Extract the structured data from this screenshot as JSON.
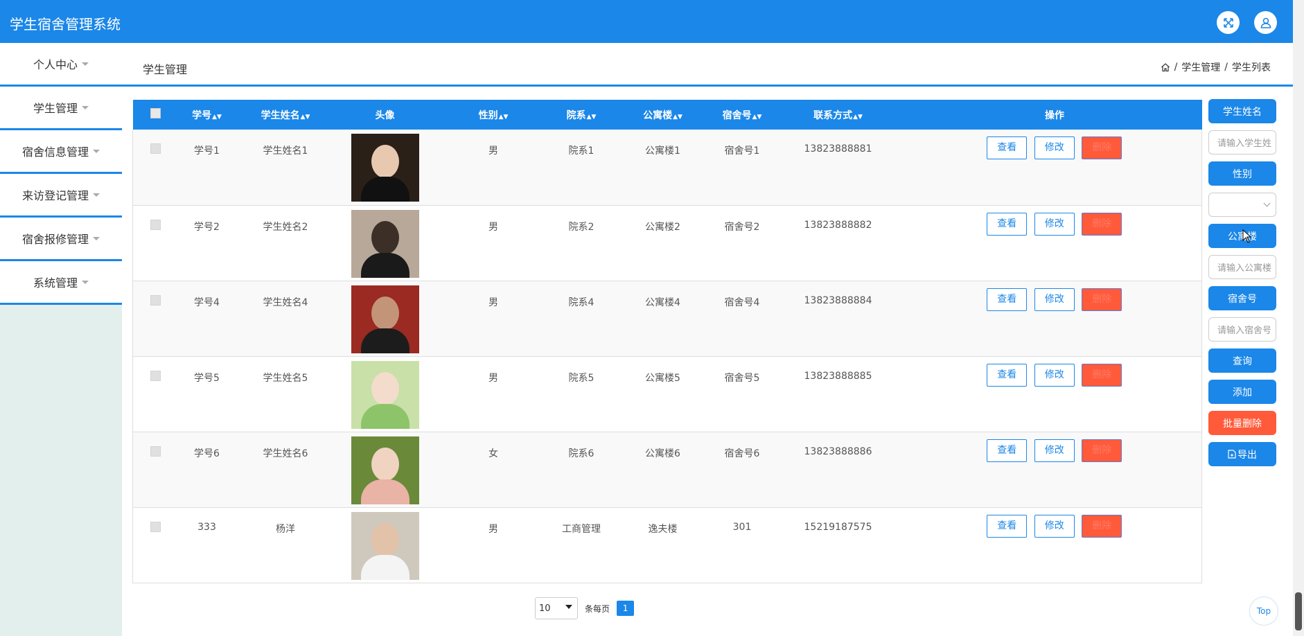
{
  "app": {
    "title": "学生宿舍管理系统"
  },
  "colors": {
    "primary": "#1b87e8",
    "danger": "#ff5a3a"
  },
  "header_icons": [
    "fullscreen-icon",
    "user-icon"
  ],
  "sidebar": {
    "items": [
      {
        "label": "个人中心"
      },
      {
        "label": "学生管理"
      },
      {
        "label": "宿舍信息管理"
      },
      {
        "label": "来访登记管理"
      },
      {
        "label": "宿舍报修管理"
      },
      {
        "label": "系统管理"
      }
    ]
  },
  "subheader": {
    "title": "学生管理"
  },
  "breadcrumb": {
    "home_icon": "home-icon",
    "items": [
      "学生管理",
      "学生列表"
    ],
    "separator": "/"
  },
  "table": {
    "columns": [
      "学号",
      "学生姓名",
      "头像",
      "性别",
      "院系",
      "公寓楼",
      "宿舍号",
      "联系方式",
      "操作"
    ],
    "sortable": [
      true,
      true,
      false,
      true,
      true,
      true,
      true,
      true,
      false
    ],
    "rows": [
      {
        "id": "学号1",
        "name": "学生姓名1",
        "gender": "男",
        "dept": "院系1",
        "building": "公寓楼1",
        "room": "宿舍号1",
        "phone": "13823888881"
      },
      {
        "id": "学号2",
        "name": "学生姓名2",
        "gender": "男",
        "dept": "院系2",
        "building": "公寓楼2",
        "room": "宿舍号2",
        "phone": "13823888882"
      },
      {
        "id": "学号4",
        "name": "学生姓名4",
        "gender": "男",
        "dept": "院系4",
        "building": "公寓楼4",
        "room": "宿舍号4",
        "phone": "13823888884"
      },
      {
        "id": "学号5",
        "name": "学生姓名5",
        "gender": "男",
        "dept": "院系5",
        "building": "公寓楼5",
        "room": "宿舍号5",
        "phone": "13823888885"
      },
      {
        "id": "学号6",
        "name": "学生姓名6",
        "gender": "女",
        "dept": "院系6",
        "building": "公寓楼6",
        "room": "宿舍号6",
        "phone": "13823888886"
      },
      {
        "id": "333",
        "name": "杨洋",
        "gender": "男",
        "dept": "工商管理",
        "building": "逸夫楼",
        "room": "301",
        "phone": "15219187575"
      }
    ],
    "actions": {
      "view": "查看",
      "edit": "修改",
      "delete": "删除"
    }
  },
  "search_panel": {
    "name_label": "学生姓名",
    "name_placeholder": "请输入学生姓",
    "gender_label": "性别",
    "gender_value": "",
    "building_label": "公寓楼",
    "building_placeholder": "请输入公寓楼",
    "room_label": "宿舍号",
    "room_placeholder": "请输入宿舍号",
    "query_label": "查询",
    "add_label": "添加",
    "batch_delete_label": "批量删除",
    "export_label": "导出"
  },
  "pagination": {
    "page_size": "10",
    "per_page_label": "条每页",
    "current_page": "1"
  },
  "back_to_top": "Top"
}
